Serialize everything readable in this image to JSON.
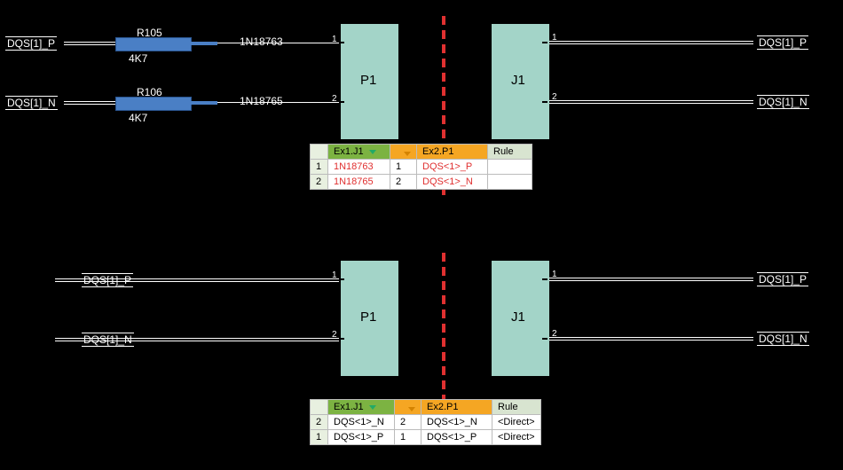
{
  "top": {
    "left_nets": [
      "DQS[1]_P",
      "DQS[1]_N"
    ],
    "right_nets": [
      "DQS[1]_P",
      "DQS[1]_N"
    ],
    "resistors": [
      {
        "ref": "R105",
        "value": "4K7"
      },
      {
        "ref": "R106",
        "value": "4K7"
      }
    ],
    "mid_nets": [
      "1N18763",
      "1N18765"
    ],
    "left_block": "P1",
    "right_block": "J1",
    "pins_left": [
      "1",
      "2"
    ],
    "pins_right": [
      "1",
      "2"
    ],
    "table": {
      "headers": {
        "col1": "Ex1.J1",
        "col2": "",
        "col3": "Ex2.P1",
        "col4": "Rule"
      },
      "rows": [
        {
          "n": "1",
          "a": "1N18763",
          "b": "1",
          "c": "DQS<1>_P",
          "d": ""
        },
        {
          "n": "2",
          "a": "1N18765",
          "b": "2",
          "c": "DQS<1>_N",
          "d": ""
        }
      ]
    }
  },
  "bottom": {
    "left_nets": [
      "DQS[1]_P",
      "DQS[1]_N"
    ],
    "right_nets": [
      "DQS[1]_P",
      "DQS[1]_N"
    ],
    "left_block": "P1",
    "right_block": "J1",
    "pins_left": [
      "1",
      "2"
    ],
    "pins_right": [
      "1",
      "2"
    ],
    "table": {
      "headers": {
        "col1": "Ex1.J1",
        "col2": "",
        "col3": "Ex2.P1",
        "col4": "Rule"
      },
      "rows": [
        {
          "n": "2",
          "a": "DQS<1>_N",
          "b": "2",
          "c": "DQS<1>_N",
          "d": "<Direct>"
        },
        {
          "n": "1",
          "a": "DQS<1>_P",
          "b": "1",
          "c": "DQS<1>_P",
          "d": "<Direct>"
        }
      ]
    }
  }
}
